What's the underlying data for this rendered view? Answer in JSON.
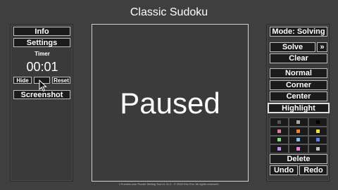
{
  "app": {
    "title": "Classic Sudoku"
  },
  "left_panel": {
    "info_label": "Info",
    "settings_label": "Settings",
    "timer_label": "Timer",
    "timer_value": "00:01",
    "hide_label": "Hide",
    "reset_label": "Reset",
    "screenshot_label": "Screenshot"
  },
  "board": {
    "status_text": "Paused"
  },
  "right_panel": {
    "mode_label": "Mode: Solving",
    "solve_label": "Solve",
    "more_label": "»",
    "clear_label": "Clear",
    "normal_label": "Normal",
    "corner_label": "Corner",
    "center_label": "Center",
    "highlight_label": "Highlight",
    "palette": [
      "#555555",
      "#aaaaaa",
      "#000000",
      "#e07a9a",
      "#f08030",
      "#f0e040",
      "#80e080",
      "#80c0f0",
      "#6080f0",
      "#c090f0",
      "#f080e0",
      "#c0c0c0"
    ],
    "delete_label": "Delete",
    "undo_label": "Undo",
    "redo_label": "Redo"
  },
  "footer": {
    "text": "f-Puzzles.com Puzzle Setting Tool v1.11.2 - © 2020 Eric Fox. All rights reserved."
  },
  "colors": {
    "background": "#3f3f3f",
    "button_bg": "#1b1b1b",
    "button_border": "#bdbdbd"
  }
}
